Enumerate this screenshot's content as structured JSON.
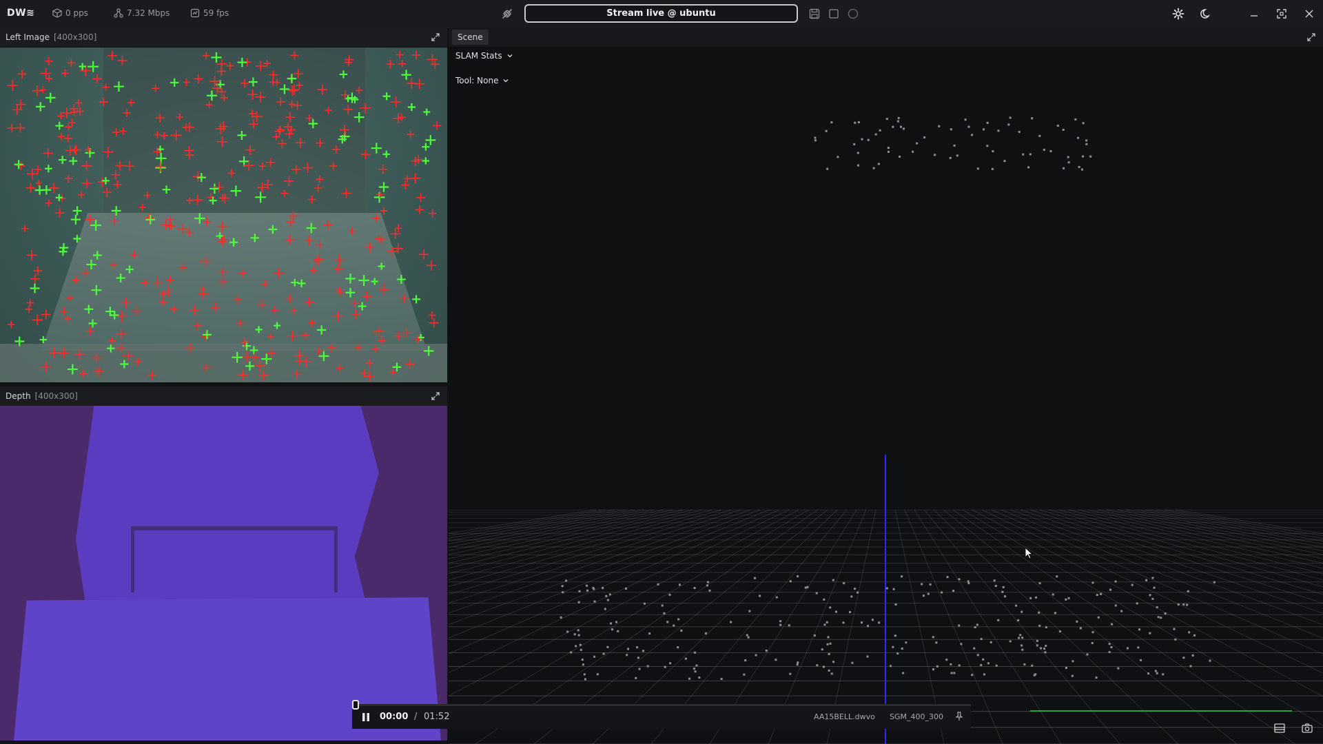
{
  "topbar": {
    "logo": "DW≋",
    "packets": "0 pps",
    "bandwidth": "7.32 Mbps",
    "fps": "59 fps",
    "stream_label": "Stream live @ ubuntu"
  },
  "left_panel": {
    "title": "Left Image",
    "dims": "[400x300]"
  },
  "depth_panel": {
    "title": "Depth",
    "dims": "[400x300]"
  },
  "scene_panel": {
    "title": "Scene",
    "slam_dropdown": "SLAM Stats",
    "tool_dropdown": "Tool: None"
  },
  "playback": {
    "current": "00:00",
    "separator": "/",
    "total": "01:52",
    "progress": 0,
    "file": "AA15BELL.dwvo",
    "algorithm": "SGM_400_300"
  },
  "colors": {
    "feature_red": "#ff2a2a",
    "feature_green": "#4dff3a",
    "axis_blue": "#2a2aff",
    "depth_dark": "#4a2a6b",
    "depth_light": "#5b3cc0",
    "timeline_green": "#1fa64a"
  },
  "icons": [
    "cube-icon",
    "network-icon",
    "fps-icon",
    "link-icon",
    "save-icon",
    "stop-icon",
    "record-icon",
    "gear-icon",
    "moon-icon",
    "minimize-icon",
    "fullscreen-icon",
    "close-icon",
    "expand-icon",
    "chevron-down-icon",
    "pause-icon",
    "pin-icon",
    "layout-icon",
    "camera-icon"
  ]
}
